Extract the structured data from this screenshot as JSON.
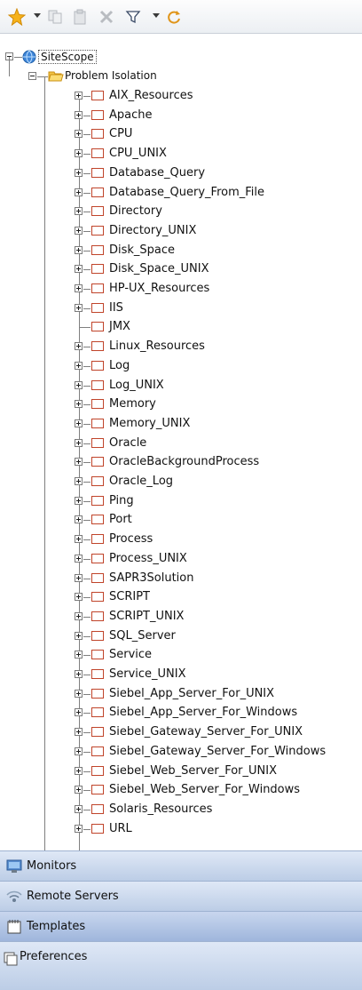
{
  "toolbar": {
    "icons": [
      "new-star-icon",
      "copy-icon",
      "paste-icon",
      "delete-icon",
      "filter-icon",
      "refresh-icon"
    ]
  },
  "tree": {
    "root_label": "SiteScope",
    "group_label": "Problem Isolation",
    "items": [
      "AIX_Resources",
      "Apache",
      "CPU",
      "CPU_UNIX",
      "Database_Query",
      "Database_Query_From_File",
      "Directory",
      "Directory_UNIX",
      "Disk_Space",
      "Disk_Space_UNIX",
      "HP-UX_Resources",
      "IIS",
      "JMX",
      "Linux_Resources",
      "Log",
      "Log_UNIX",
      "Memory",
      "Memory_UNIX",
      "Oracle",
      "OracleBackgroundProcess",
      "Oracle_Log",
      "Ping",
      "Port",
      "Process",
      "Process_UNIX",
      "SAPR3Solution",
      "SCRIPT",
      "SCRIPT_UNIX",
      "SQL_Server",
      "Service",
      "Service_UNIX",
      "Siebel_App_Server_For_UNIX",
      "Siebel_App_Server_For_Windows",
      "Siebel_Gateway_Server_For_UNIX",
      "Siebel_Gateway_Server_For_Windows",
      "Siebel_Web_Server_For_UNIX",
      "Siebel_Web_Server_For_Windows",
      "Solaris_Resources",
      "URL"
    ],
    "leaf_items": [
      "JMX"
    ]
  },
  "panels": {
    "monitors": "Monitors",
    "remote_servers": "Remote Servers",
    "templates": "Templates",
    "preferences": "Preferences",
    "selected": "templates"
  },
  "colors": {
    "folder_box": "#c0442a",
    "panel_bar": "#bccde6",
    "panel_selected": "#9fb6dc"
  }
}
